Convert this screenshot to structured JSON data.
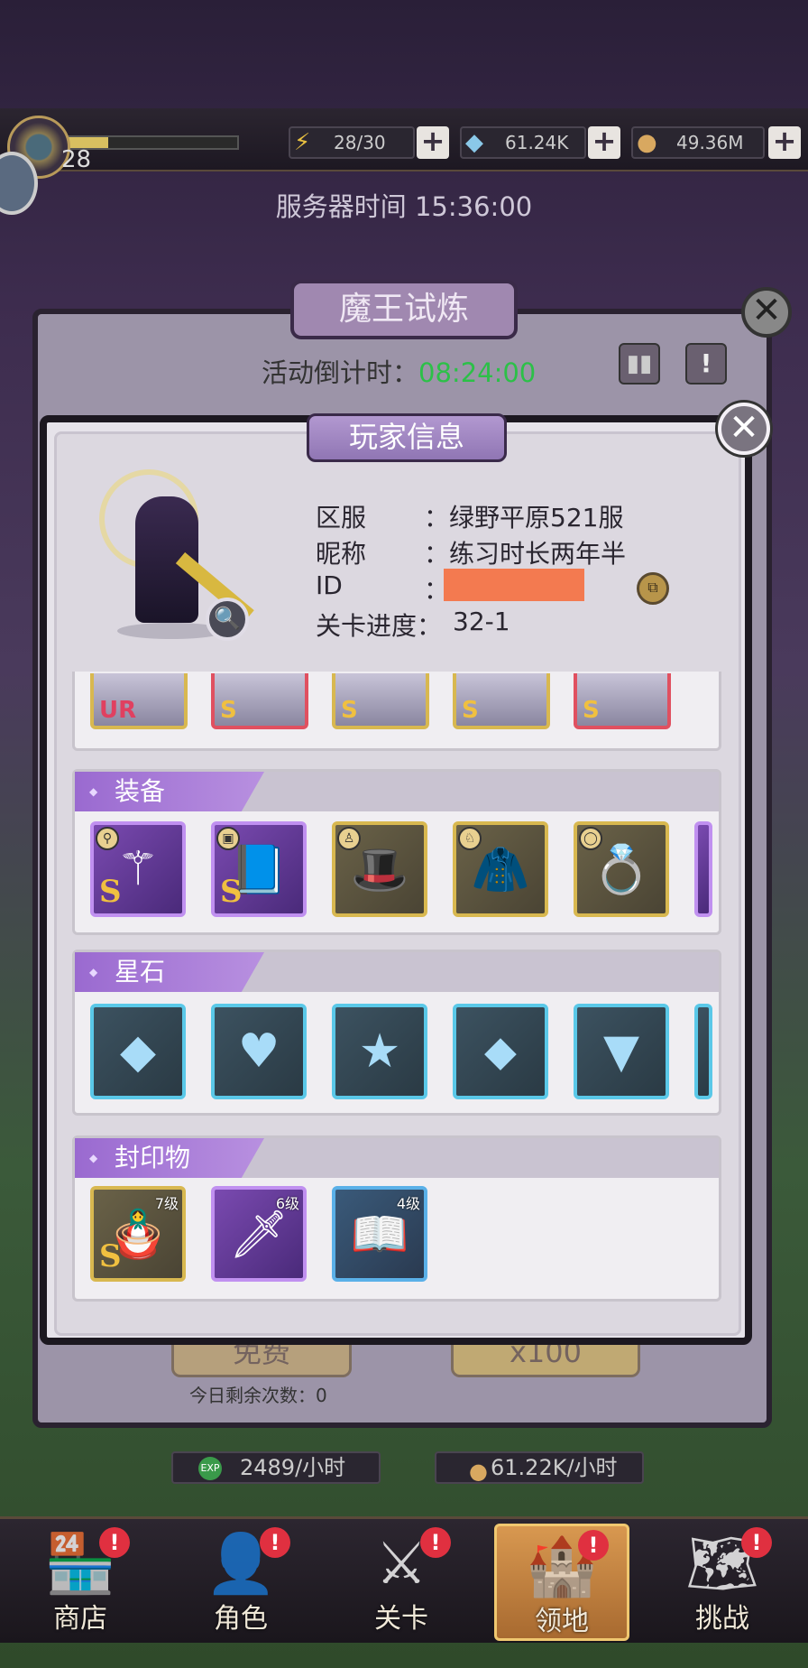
{
  "topbar": {
    "level": "28",
    "exp_fraction": 0.25,
    "energy": "28/30",
    "gems": "61.24K",
    "gold": "49.36M",
    "plus": "+"
  },
  "server_time": "服务器时间 15:36:00",
  "trial": {
    "title": "魔王试炼",
    "countdown_label": "活动倒计时：",
    "countdown_value": "08:24:00",
    "free_label": "免费",
    "gem_label": "x100",
    "remaining": "今日剩余次数：0",
    "exp_rate": "2489/小时",
    "gold_rate": "61.22K/小时",
    "close": "✕",
    "rank_icon": "▮▮",
    "info_icon": "!"
  },
  "player_info": {
    "title": "玩家信息",
    "close": "✕",
    "fields": [
      {
        "label": "区服",
        "value": "：绿野平原521服"
      },
      {
        "label": "昵称",
        "value": "：练习时长两年半"
      },
      {
        "label": "ID",
        "value": "："
      },
      {
        "label": "关卡进度：",
        "value": "32-1"
      }
    ],
    "copy_icon": "⧉",
    "magnify_icon": "🔍"
  },
  "heroes": [
    {
      "rarity": "UR",
      "color": "#d8b850",
      "tcolor": "#e04060"
    },
    {
      "rarity": "S",
      "color": "#e05060",
      "tcolor": "#f0c040"
    },
    {
      "rarity": "S",
      "color": "#d8b850",
      "tcolor": "#f0c040"
    },
    {
      "rarity": "S",
      "color": "#d8b850",
      "tcolor": "#f0c040"
    },
    {
      "rarity": "S",
      "color": "#e05060",
      "tcolor": "#f0c040"
    }
  ],
  "equipment": {
    "title": "装备",
    "items": [
      {
        "name": "staff",
        "glyph": "⚚",
        "rarity": "S",
        "frame": "purple",
        "badge": "⚲"
      },
      {
        "name": "book",
        "glyph": "📘",
        "rarity": "S",
        "frame": "purple",
        "badge": "▣"
      },
      {
        "name": "hat",
        "glyph": "🎩",
        "rarity": "",
        "frame": "gold",
        "badge": "♙"
      },
      {
        "name": "cloak",
        "glyph": "🧥",
        "rarity": "",
        "frame": "gold",
        "badge": "♘"
      },
      {
        "name": "ring",
        "glyph": "💍",
        "rarity": "",
        "frame": "gold",
        "badge": "◯"
      }
    ]
  },
  "starstones": {
    "title": "星石",
    "items": [
      {
        "name": "square",
        "glyph": "◆"
      },
      {
        "name": "heart",
        "glyph": "♥"
      },
      {
        "name": "star",
        "glyph": "★"
      },
      {
        "name": "diamond",
        "glyph": "⬥"
      },
      {
        "name": "triangle",
        "glyph": "▼"
      }
    ]
  },
  "seals": {
    "title": "封印物",
    "items": [
      {
        "name": "doll",
        "glyph": "🪆",
        "rarity": "S",
        "frame": "gold",
        "level": "7级"
      },
      {
        "name": "dagger",
        "glyph": "🗡",
        "rarity": "",
        "frame": "purple",
        "level": "6级"
      },
      {
        "name": "golden-book",
        "glyph": "📖",
        "rarity": "",
        "frame": "blue",
        "level": "4级"
      }
    ]
  },
  "nav": [
    {
      "id": "shop",
      "label": "商店",
      "icon": "🏪"
    },
    {
      "id": "hero",
      "label": "角色",
      "icon": "👤"
    },
    {
      "id": "stage",
      "label": "关卡",
      "icon": "⚔"
    },
    {
      "id": "territory",
      "label": "领地",
      "icon": "🏰"
    },
    {
      "id": "challenge",
      "label": "挑战",
      "icon": "🗺"
    }
  ],
  "nav_alert": "!"
}
